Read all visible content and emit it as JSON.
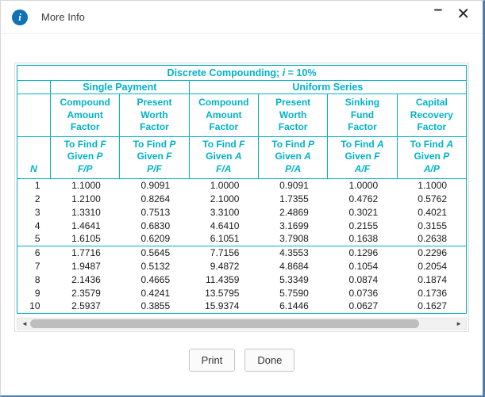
{
  "window": {
    "title": "More Info",
    "info_glyph": "i",
    "minimize_icon": "–",
    "close_icon": "✕"
  },
  "table": {
    "title_prefix": "Discrete Compounding; ",
    "title_var": "i",
    "title_suffix": " = 10%",
    "single_payment_label": "Single Payment",
    "uniform_series_label": "Uniform Series",
    "n_label": "N",
    "columns": [
      {
        "name": "Compound\nAmount\nFactor",
        "find_prefix": "To Find",
        "find_var": "F",
        "given_prefix": "Given",
        "given_var": "P",
        "ratio": "F/P"
      },
      {
        "name": "Present\nWorth\nFactor",
        "find_prefix": "To Find",
        "find_var": "P",
        "given_prefix": "Given",
        "given_var": "F",
        "ratio": "P/F"
      },
      {
        "name": "Compound\nAmount\nFactor",
        "find_prefix": "To Find",
        "find_var": "F",
        "given_prefix": "Given",
        "given_var": "A",
        "ratio": "F/A"
      },
      {
        "name": "Present\nWorth\nFactor",
        "find_prefix": "To Find",
        "find_var": "P",
        "given_prefix": "Given",
        "given_var": "A",
        "ratio": "P/A"
      },
      {
        "name": "Sinking\nFund\nFactor",
        "find_prefix": "To Find",
        "find_var": "A",
        "given_prefix": "Given",
        "given_var": "F",
        "ratio": "A/F"
      },
      {
        "name": "Capital\nRecovery\nFactor",
        "find_prefix": "To Find",
        "find_var": "A",
        "given_prefix": "Given",
        "given_var": "P",
        "ratio": "A/P"
      }
    ],
    "rows": [
      {
        "n": "1",
        "values": [
          "1.1000",
          "0.9091",
          "1.0000",
          "0.9091",
          "1.0000",
          "1.1000"
        ]
      },
      {
        "n": "2",
        "values": [
          "1.2100",
          "0.8264",
          "2.1000",
          "1.7355",
          "0.4762",
          "0.5762"
        ]
      },
      {
        "n": "3",
        "values": [
          "1.3310",
          "0.7513",
          "3.3100",
          "2.4869",
          "0.3021",
          "0.4021"
        ]
      },
      {
        "n": "4",
        "values": [
          "1.4641",
          "0.6830",
          "4.6410",
          "3.1699",
          "0.2155",
          "0.3155"
        ]
      },
      {
        "n": "5",
        "values": [
          "1.6105",
          "0.6209",
          "6.1051",
          "3.7908",
          "0.1638",
          "0.2638"
        ]
      },
      {
        "n": "6",
        "values": [
          "1.7716",
          "0.5645",
          "7.7156",
          "4.3553",
          "0.1296",
          "0.2296"
        ]
      },
      {
        "n": "7",
        "values": [
          "1.9487",
          "0.5132",
          "9.4872",
          "4.8684",
          "0.1054",
          "0.2054"
        ]
      },
      {
        "n": "8",
        "values": [
          "2.1436",
          "0.4665",
          "11.4359",
          "5.3349",
          "0.0874",
          "0.1874"
        ]
      },
      {
        "n": "9",
        "values": [
          "2.3579",
          "0.4241",
          "13.5795",
          "5.7590",
          "0.0736",
          "0.1736"
        ]
      },
      {
        "n": "10",
        "values": [
          "2.5937",
          "0.3855",
          "15.9374",
          "6.1446",
          "0.0627",
          "0.1627"
        ]
      }
    ]
  },
  "scrollbar": {
    "left_arrow": "◄",
    "right_arrow": "►"
  },
  "buttons": {
    "print": "Print",
    "done": "Done"
  },
  "colors": {
    "accent": "#00b2c8",
    "info": "#1173b5"
  }
}
